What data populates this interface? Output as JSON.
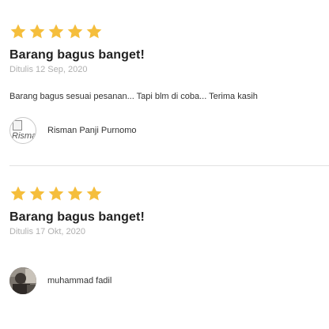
{
  "reviews": [
    {
      "rating": 5,
      "title": "Barang bagus banget!",
      "date": "Ditulis 12 Sep, 2020",
      "body": "Barang bagus sesuai pesanan... Tapi blm di coba... Terima kasih",
      "author": "Risman Panji Purnomo",
      "avatar_alt": "Risman Panji Purnomo"
    },
    {
      "rating": 5,
      "title": "Barang bagus banget!",
      "date": "Ditulis 17 Okt, 2020",
      "body": "",
      "author": "muhammad fadil"
    }
  ],
  "colors": {
    "star": "#F5BE3C",
    "divider": "#E2E2E2",
    "date": "#B0B0B0"
  },
  "icons": {
    "star": "star-icon",
    "broken_image": "broken-image-icon"
  }
}
